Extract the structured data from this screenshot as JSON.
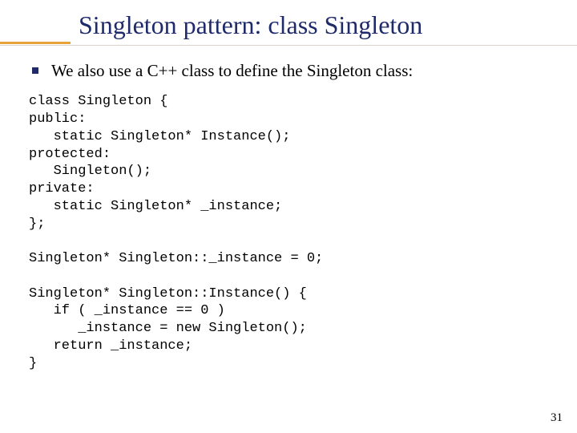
{
  "title": "Singleton pattern: class Singleton",
  "bullet": "We also use a C++ class to define the Singleton class:",
  "code": "class Singleton {\npublic:\n   static Singleton* Instance();\nprotected:\n   Singleton();\nprivate:\n   static Singleton* _instance;\n};\n\nSingleton* Singleton::_instance = 0;\n\nSingleton* Singleton::Instance() {\n   if ( _instance == 0 )\n      _instance = new Singleton();\n   return _instance;\n}",
  "slide_number": "31"
}
